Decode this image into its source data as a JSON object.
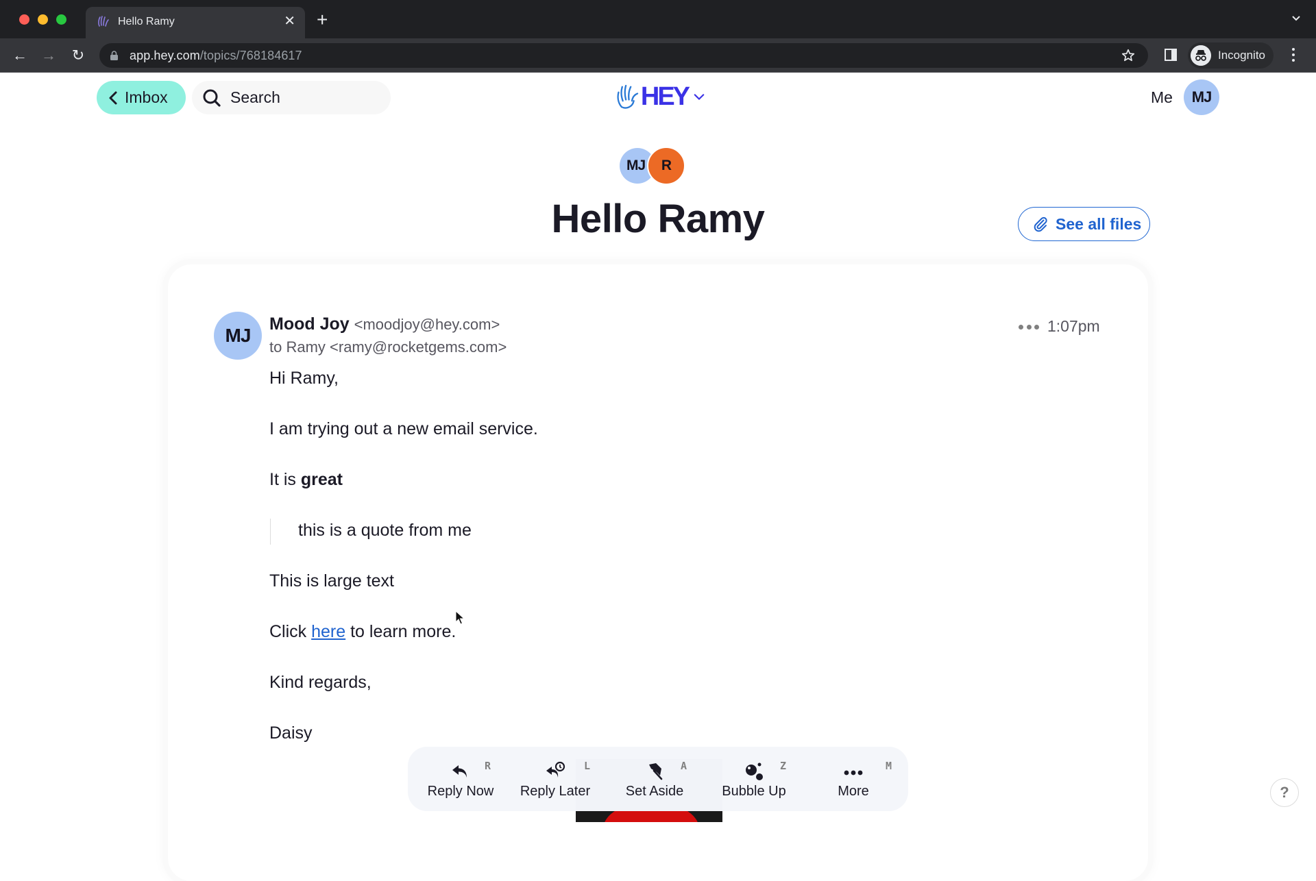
{
  "browser": {
    "tab_title": "Hello Ramy",
    "url_host": "app.hey.com",
    "url_path": "/topics/768184617",
    "profile_label": "Incognito",
    "icons": {
      "close": "close-icon",
      "new_tab": "plus-icon",
      "back": "arrow-left-icon",
      "forward": "arrow-right-icon",
      "reload": "reload-icon",
      "lock": "lock-icon",
      "bookmark": "star-icon",
      "side_panel": "side-panel-icon",
      "incognito": "incognito-icon",
      "menu": "kebab-menu-icon"
    },
    "glyphs": {
      "close": "✕",
      "new_tab": "+",
      "back": "←",
      "forward": "→",
      "reload": "↻"
    }
  },
  "header": {
    "back_label": "Imbox",
    "search_label": "Search",
    "logo_text": "HEY",
    "me_label": "Me",
    "me_initials": "MJ",
    "colors": {
      "imbox_bg": "#8ff0df",
      "logo": "#3b32e6",
      "avatar_bg": "#a8c6f5"
    }
  },
  "topic": {
    "participants": [
      {
        "initials": "MJ",
        "color": "#a8c6f5"
      },
      {
        "initials": "R",
        "color": "#ec6a25"
      }
    ],
    "title": "Hello Ramy",
    "files_button_label": "See all files"
  },
  "message": {
    "sender_initials": "MJ",
    "sender_name": "Mood Joy",
    "sender_email": "<moodjoy@hey.com>",
    "to_line": "to Ramy <ramy@rocketgems.com>",
    "time": "1:07pm",
    "body": {
      "greeting": "Hi Ramy,",
      "line1": "I am trying out a new email service.",
      "line2_prefix": "It is ",
      "line2_bold": "great",
      "quote": "this is a quote from me",
      "large_text": "This is large text",
      "link_prefix": "Click ",
      "link_text": "here",
      "link_suffix": " to learn more.",
      "signoff": "Kind regards,",
      "signature": "Daisy"
    },
    "link_color": "#1f63cf"
  },
  "actions": [
    {
      "label": "Reply Now",
      "key": "R",
      "icon": "reply-icon"
    },
    {
      "label": "Reply Later",
      "key": "L",
      "icon": "reply-later-icon"
    },
    {
      "label": "Set Aside",
      "key": "A",
      "icon": "pin-icon"
    },
    {
      "label": "Bubble Up",
      "key": "Z",
      "icon": "bubble-icon"
    },
    {
      "label": "More",
      "key": "M",
      "icon": "more-icon"
    }
  ],
  "help_label": "?"
}
